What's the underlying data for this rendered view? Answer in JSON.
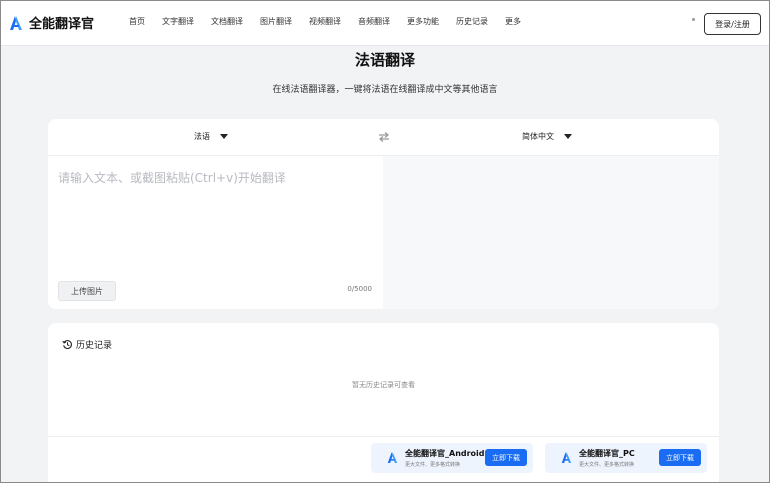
{
  "header": {
    "logo_text": "全能翻译官",
    "nav": [
      "首页",
      "文字翻译",
      "文档翻译",
      "图片翻译",
      "视频翻译",
      "音频翻译",
      "更多功能",
      "历史记录",
      "更多"
    ],
    "login_label": "登录/注册"
  },
  "page": {
    "title": "法语翻译",
    "subtitle": "在线法语翻译器，一键将法语在线翻译成中文等其他语言"
  },
  "translator": {
    "source_lang": "法语",
    "target_lang": "简体中文",
    "placeholder": "请输入文本、或截图粘贴(Ctrl+v)开始翻译",
    "upload_label": "上传图片",
    "char_count": "0/5000"
  },
  "history": {
    "title": "历史记录",
    "empty_text": "暂无历史记录可查看"
  },
  "promos": [
    {
      "name": "全能翻译官_Android",
      "desc": "更大文件、更多格式转换",
      "button": "立即下载"
    },
    {
      "name": "全能翻译官_PC",
      "desc": "更大文件、更多格式转换",
      "button": "立即下载"
    }
  ],
  "colors": {
    "accent": "#1a6cf2",
    "logo": "#1a6cf2"
  }
}
